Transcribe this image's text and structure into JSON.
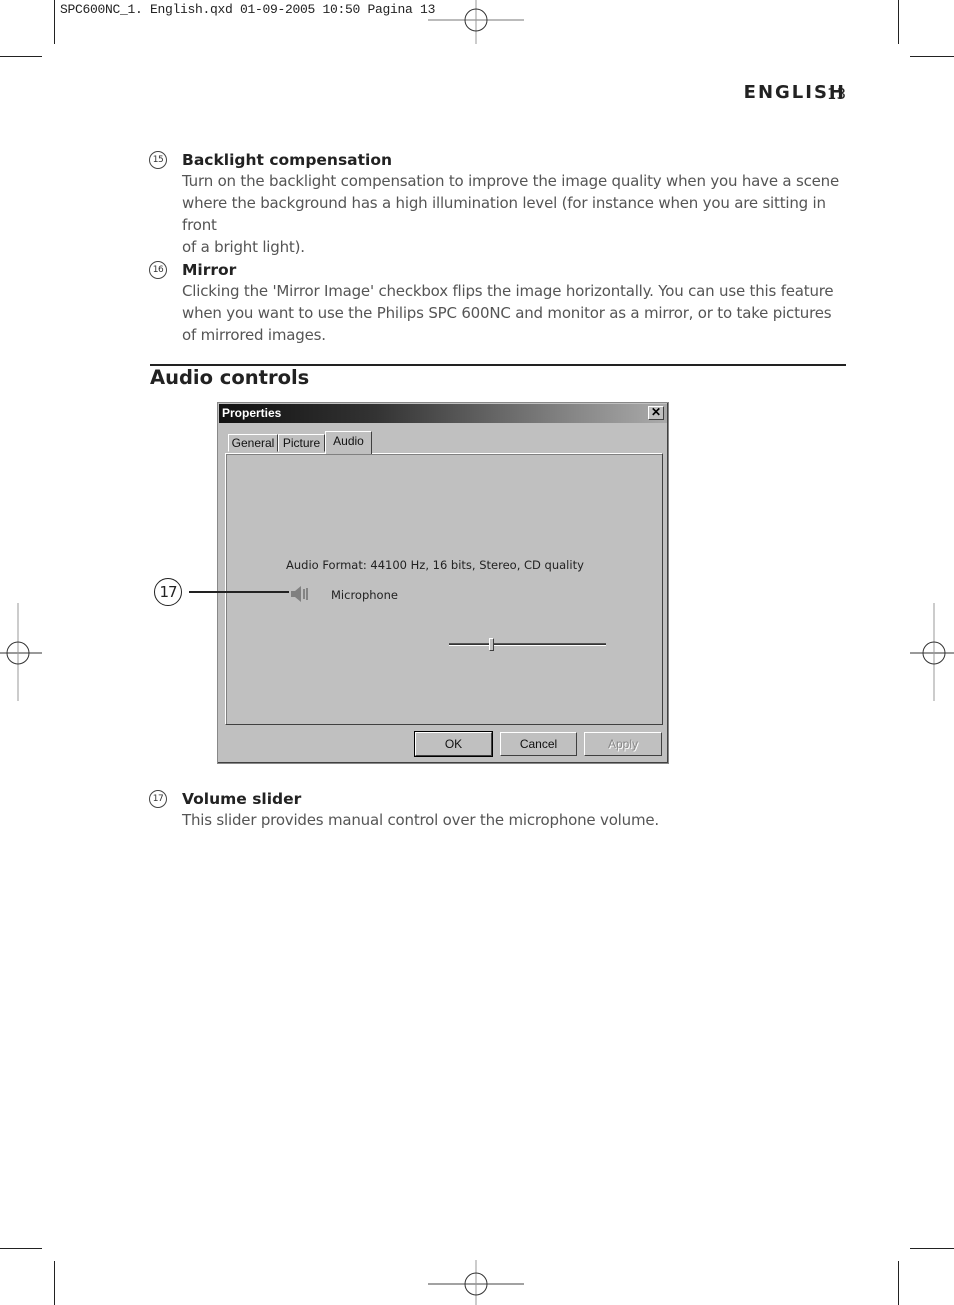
{
  "slug": "SPC600NC_1. English.qxd 01-09-2005 10:50 Pagina 13",
  "running_header": {
    "language": "ENGLISH",
    "page_number": "13"
  },
  "items": [
    {
      "number": "15",
      "title": "Backlight compensation",
      "lines": [
        "Turn on the backlight compensation to improve the image quality when you have a scene",
        "where the background has a high illumination level (for instance when you are sitting in front",
        "of a bright light)."
      ]
    },
    {
      "number": "16",
      "title": "Mirror",
      "lines": [
        "Clicking the 'Mirror Image' checkbox flips the image horizontally. You can use this feature",
        "when you want to use the Philips SPC 600NC and monitor as a mirror, or to take pictures",
        "of mirrored images."
      ]
    }
  ],
  "section_heading": "Audio controls",
  "dialog": {
    "title": "Properties",
    "close_glyph": "✕",
    "tabs": [
      {
        "label": "General",
        "active": false
      },
      {
        "label": "Picture",
        "active": false
      },
      {
        "label": "Audio",
        "active": true
      }
    ],
    "audio_format": "Audio Format: 44100 Hz, 16 bits, Stereo, CD quality",
    "microphone_label": "Microphone",
    "speaker_icon": "speaker-icon",
    "volume_percent": 27,
    "buttons": {
      "ok": "OK",
      "cancel": "Cancel",
      "apply": "Apply"
    }
  },
  "callout_number": "17",
  "volume_item": {
    "number": "17",
    "title": "Volume slider",
    "lines": [
      "This slider provides manual control over the microphone volume."
    ]
  }
}
